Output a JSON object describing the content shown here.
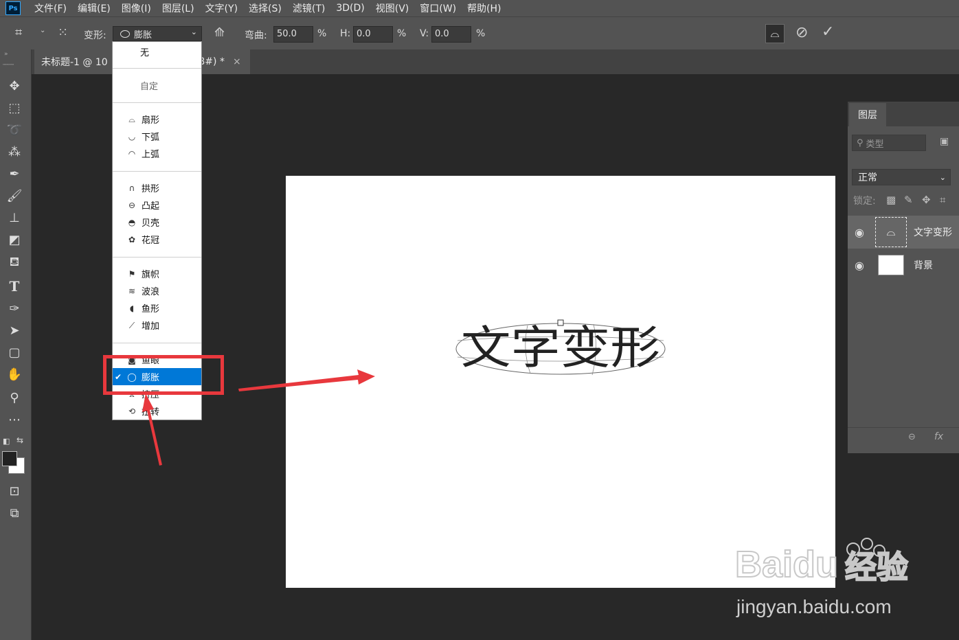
{
  "app": {
    "logo": "Ps"
  },
  "menu": [
    "文件(F)",
    "编辑(E)",
    "图像(I)",
    "图层(L)",
    "文字(Y)",
    "选择(S)",
    "滤镜(T)",
    "3D(D)",
    "视图(V)",
    "窗口(W)",
    "帮助(H)"
  ],
  "options": {
    "warp_label": "变形:",
    "warp_value": "膨胀",
    "bend_label": "弯曲:",
    "bend_value": "50.0",
    "h_label": "H:",
    "h_value": "0.0",
    "v_label": "V:",
    "v_value": "0.0",
    "percent": "%"
  },
  "tab": {
    "title_prefix": "未标题-1 @ 10",
    "title_suffix": "/8#) *",
    "close": "×"
  },
  "dropdown": {
    "items": [
      "无",
      "自定",
      "扇形",
      "下弧",
      "上弧",
      "拱形",
      "凸起",
      "贝壳",
      "花冠",
      "旗帜",
      "波浪",
      "鱼形",
      "增加",
      "鱼眼",
      "膨胀",
      "挤压",
      "扭转"
    ],
    "selected": "膨胀",
    "checkmark": "✔"
  },
  "canvas_text": "文字变形",
  "layers": {
    "tab": "图层",
    "search_placeholder": "类型",
    "blend_mode": "正常",
    "lock_label": "锁定:",
    "items": [
      {
        "name": "文字变形",
        "type": "text",
        "visible": true
      },
      {
        "name": "背景",
        "type": "background",
        "visible": true
      }
    ],
    "footer": {
      "link": "⊖",
      "fx": "fx"
    }
  },
  "watermark": {
    "brand": "Baidu",
    "suffix": "经验",
    "url": "jingyan.baidu.com"
  },
  "colors": {
    "ui_dark": "#535353",
    "canvas_bg": "#282828",
    "selected": "#0078d7",
    "annotation": "#e8383d"
  }
}
